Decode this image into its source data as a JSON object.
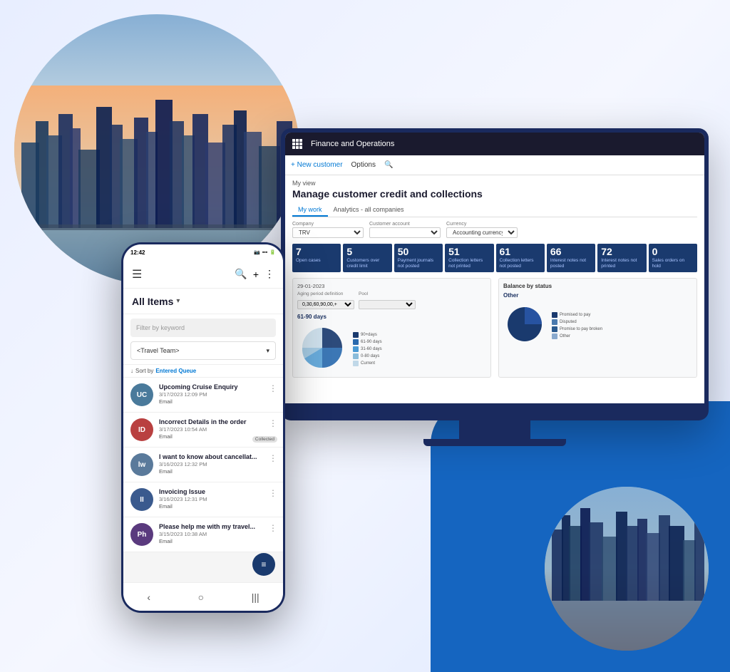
{
  "app": {
    "title": "Finance and Operations",
    "status_time": "12:42"
  },
  "background": {
    "blue_accent": "#1565c0",
    "dark_blue": "#1a2a5e"
  },
  "monitor": {
    "header": {
      "title": "Finance and Operations",
      "toolbar_new_customer": "+ New customer",
      "toolbar_options": "Options"
    },
    "breadcrumb": "My view",
    "page_title": "Manage customer credit and collections",
    "tabs": [
      {
        "label": "My work",
        "active": true
      },
      {
        "label": "Analytics - all companies",
        "active": false
      }
    ],
    "filters": {
      "company_label": "Company",
      "company_value": "TRV",
      "customer_label": "Customer account",
      "currency_label": "Currency",
      "currency_value": "Accounting currency"
    },
    "kpi_tiles": [
      {
        "number": "7",
        "label": "Open cases"
      },
      {
        "number": "5",
        "label": "Customers over credit limit"
      },
      {
        "number": "50",
        "label": "Payment journals not posted"
      },
      {
        "number": "51",
        "label": "Collection letters not printed"
      },
      {
        "number": "61",
        "label": "Collection letters not posted"
      },
      {
        "number": "66",
        "label": "Interest notes not posted"
      },
      {
        "number": "72",
        "label": "Interest notes not printed"
      },
      {
        "number": "0",
        "label": "Sales orders on hold"
      }
    ],
    "chart_left": {
      "title": "61-90 days",
      "filter_label": "Aging period definition",
      "filter_value": "0,30,60,90,00,+",
      "date": "29-01-2023",
      "segments": [
        "90+days",
        "61-90 days",
        "31-60 days",
        "0-80 days",
        "Current"
      ]
    },
    "chart_right": {
      "title": "Other",
      "filter_label": "Pool",
      "legend": [
        "Promised to pay",
        "Disputed",
        "Promise to pay broken",
        "Other"
      ]
    }
  },
  "phone": {
    "status_bar": {
      "time": "12:42",
      "icons": "📷📷📷0 ·"
    },
    "all_items_label": "All Items",
    "filter_placeholder": "Filter by keyword",
    "team_select": "<Travel Team>",
    "sort_label": "Sort by",
    "sort_field": "Entered Queue",
    "emails": [
      {
        "initials": "UC",
        "avatar_color": "#4a7a9b",
        "subject": "Upcoming Cruise Enquiry",
        "date": "3/17/2023 12:09 PM",
        "type": "Email"
      },
      {
        "initials": "ID",
        "avatar_color": "#b94040",
        "subject": "Incorrect Details in the order",
        "date": "3/17/2023 10:54 AM",
        "type": "Email",
        "badge": "Collected"
      },
      {
        "initials": "lw",
        "avatar_color": "#5a7a9b",
        "subject": "I want to know about cancellat...",
        "date": "3/16/2023 12:32 PM",
        "type": "Email"
      },
      {
        "initials": "II",
        "avatar_color": "#3a5a8e",
        "subject": "Invoicing Issue",
        "date": "3/16/2023 12:31 PM",
        "type": "Email"
      },
      {
        "initials": "Ph",
        "avatar_color": "#5a3a7e",
        "subject": "Please help me with my travel...",
        "date": "3/15/2023 10:38 AM",
        "type": "Email"
      }
    ]
  }
}
